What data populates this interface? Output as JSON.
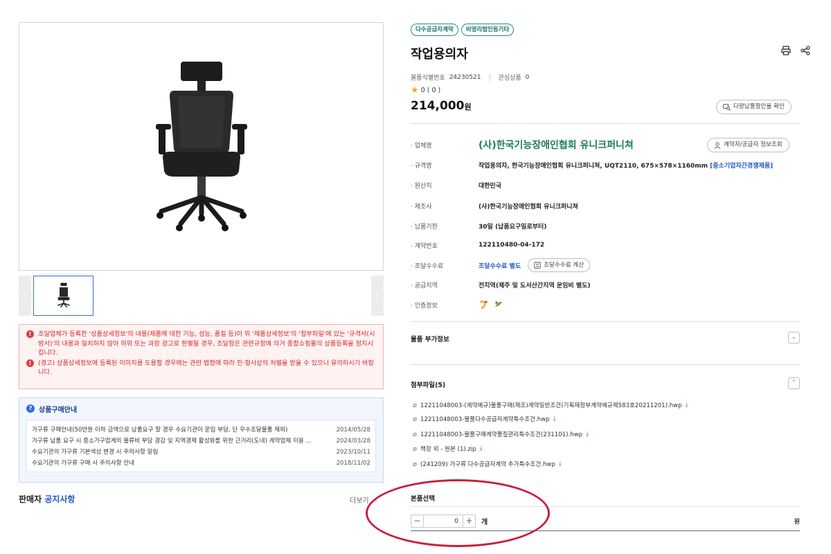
{
  "gallery": {
    "prev_arrow": "‹",
    "next_arrow": "›"
  },
  "warnings": [
    "조달업체가 등록한 '상품상세정보'의 내용(제품에 대한 기능, 성능, 품질 등)이 위 '제품상세정보'의 '첨부파일'에 있는 '규격서(시방서)'의 내용과 일치하지 않아 허위 또는 과장 광고로 판별될 경우, 조달청은 관련규정에 의거 종합쇼핑몰의 상품등록을 정지시킵니다.",
    "(경고) 상품상세정보에 등록된 이미지를 도용할 경우에는 관련 법령에 따라 민·형사상의 처벌을 받을 수 있으니 유의하시기 바랍니다."
  ],
  "guide": {
    "title": "상품구매안내",
    "items": [
      {
        "text": "가구류 구매안내(50만원 이하 금액으로 납품요구 할 경우 수요기관이 운임 부담, 단 우수조달물품 제외)",
        "date": "2014/05/28"
      },
      {
        "text": "가구류 납품 요구 시 중소가구업계의 물류비 부담 경감 및 지역경제 활성화를 위한 근거리(도내) 계약업체 이용 ...",
        "date": "2024/03/28"
      },
      {
        "text": "수요기관의 가구류 기본색상 변경 시 주의사항 알림",
        "date": "2023/10/11"
      },
      {
        "text": "수요기관의 가구류 구매 시 주의사항 안내",
        "date": "2018/11/02"
      }
    ]
  },
  "seller_notice": {
    "prefix": "판매자",
    "highlight": "공지사항",
    "more": "더보기"
  },
  "product": {
    "badges": [
      "다수공급자계약",
      "비영리법인등기타"
    ],
    "title": "작업용의자",
    "id_label": "물품식별번호",
    "id_value": "24230521",
    "interest_label": "관심상품",
    "interest_value": "0",
    "rating_text": "0 ( 0 )",
    "price_value": "214,000",
    "price_unit": "원",
    "discount_button": "다량납품할인율 확인",
    "vendor_button": "계약자/공급자 정보조회",
    "fee_button": "조달수수료 계산"
  },
  "specs": {
    "company": {
      "label": "업체명",
      "value": "(사)한국기능장애인협회 유니크퍼니쳐"
    },
    "standard": {
      "label": "규격명",
      "value": "작업용의자, 한국기능장애인협회 유니크퍼니쳐, UQT2110, 675×578×1160mm",
      "tag": "[중소기업자간경쟁제품]"
    },
    "origin": {
      "label": "원산지",
      "value": "대한민국"
    },
    "maker": {
      "label": "제조사",
      "value": "(사)한국기능장애인협회 유니크퍼니쳐"
    },
    "delivery": {
      "label": "납품기한",
      "value": "30일 (납품요구일로부터)"
    },
    "contract": {
      "label": "계약번호",
      "value": "122110480-04-172"
    },
    "fee": {
      "label": "조달수수료",
      "value": "조달수수료 별도"
    },
    "region": {
      "label": "공급지역",
      "value": "전지역(제주 및 도서산간지역 운임비 별도)"
    },
    "cert": {
      "label": "인증정보"
    }
  },
  "sections": {
    "extra_info": "물품 부가정보",
    "attachments": "첨부파일(5)",
    "select": "본품선택"
  },
  "attachments": [
    "12211048003-(계약예규)물품구매(제조)계약일반조건(기획재정부계약예규제583호20211201).hwp",
    "12211048003-물품다수공급자계약특수조건.hwp",
    "12211048003-물품구매계약품질관리특수조건(231101).hwp",
    "책장 외 - 원본 (1).zip",
    "(241209) 가구류 다수공급자계약 추가특수조건.hwp"
  ],
  "quantity": {
    "value": "0",
    "unit": "개",
    "currency": "원"
  },
  "colors": {
    "accent": "#1a7d58",
    "link": "#1f57c7",
    "warning": "#d0262a",
    "highlight": "#cc1d3a"
  }
}
